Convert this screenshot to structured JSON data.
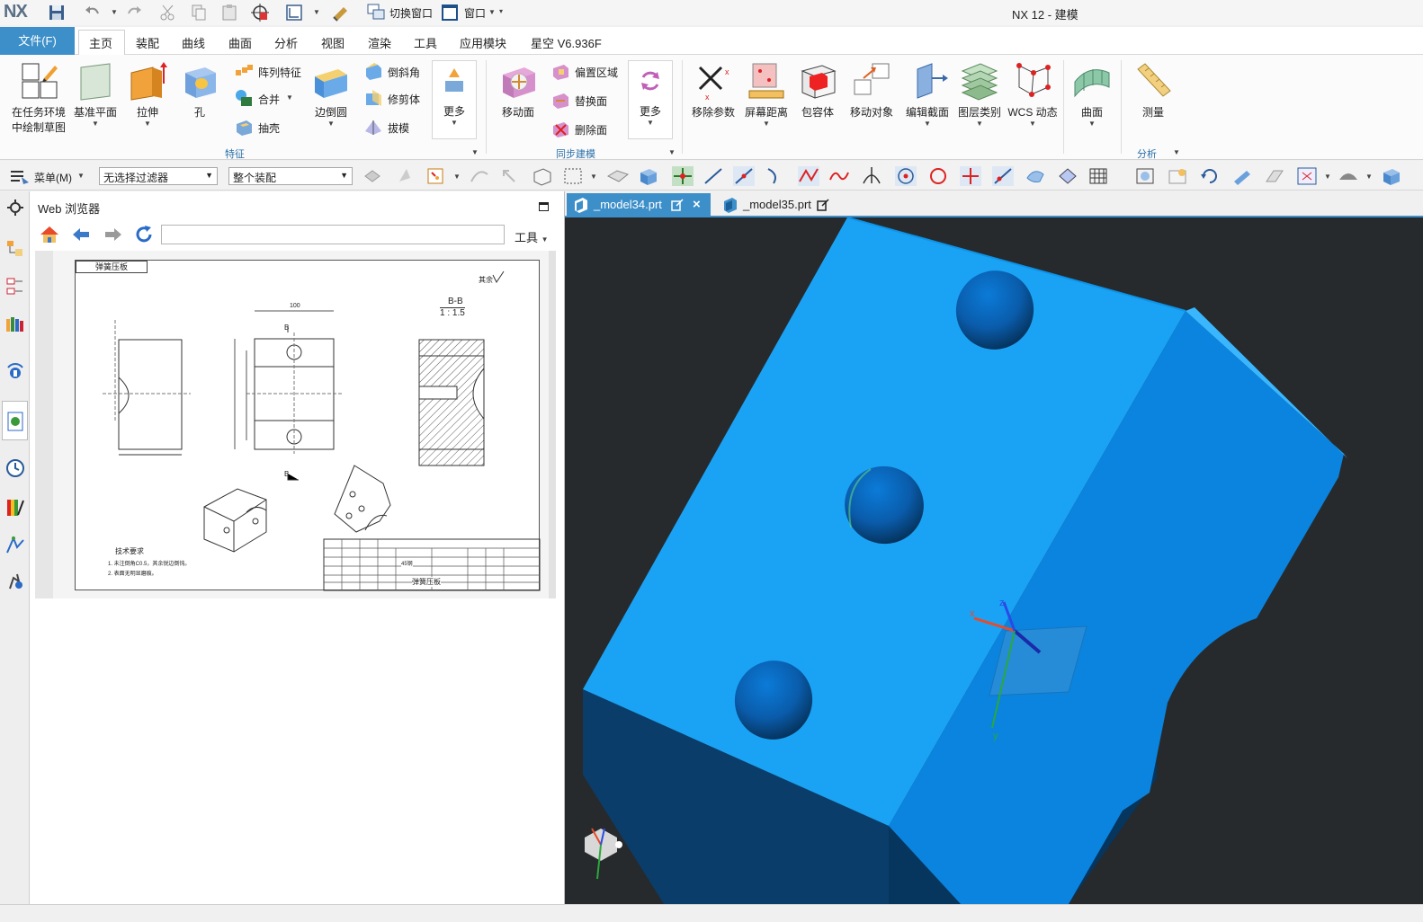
{
  "app": {
    "logo": "NX",
    "window_title": "NX 12 - 建模",
    "quick_access": {
      "switch_window": "切换窗口",
      "window": "窗口"
    }
  },
  "ribbon_tabs": {
    "file": "文件(F)",
    "items": [
      "主页",
      "装配",
      "曲线",
      "曲面",
      "分析",
      "视图",
      "渲染",
      "工具",
      "应用模块",
      "星空 V6.936F"
    ],
    "active": "主页"
  },
  "ribbon": {
    "sketch": "在任务环境\n中绘制草图",
    "sketch_l1": "在任务环境",
    "sketch_l2": "中绘制草图",
    "datum_plane": "基准平面",
    "extrude": "拉伸",
    "hole": "孔",
    "pattern_feature": "阵列特征",
    "unite": "合并",
    "shell": "抽壳",
    "edge_blend": "边倒圆",
    "chamfer": "倒斜角",
    "trim_body": "修剪体",
    "draft": "拔模",
    "more_1": "更多",
    "group_feature": "特征",
    "move_face": "移动面",
    "offset_region": "偏置区域",
    "replace_face": "替换面",
    "delete_face": "删除面",
    "more_2": "更多",
    "group_sync": "同步建模",
    "remove_params": "移除参数",
    "screen_distance": "屏幕距离",
    "bounding_body": "包容体",
    "move_object": "移动对象",
    "edit_section": "编辑截面",
    "layer_category": "图层类别",
    "wcs_dynamic": "WCS 动态",
    "surface": "曲面",
    "measure": "测量",
    "group_analysis": "分析"
  },
  "selection_bar": {
    "menu": "菜单(M)",
    "filter": "无选择过滤器",
    "scope": "整个装配"
  },
  "web_browser": {
    "title": "Web 浏览器",
    "url": "",
    "tools": "工具"
  },
  "drawing": {
    "title_box": "弹簧压板",
    "roughness": "其余",
    "section_label": "B-B",
    "section_scale": "1 : 1.5",
    "tech_req_title": "技术要求",
    "tech_req_1": "1. 未注倒角C0.5，其余锐边倒钝。",
    "tech_req_2": "2. 表面无明显磨痕。",
    "material": "45钢",
    "part_name": "弹簧压板",
    "dim_100": "100",
    "section_mark": "B"
  },
  "doc_tabs": [
    {
      "label": "_model34.prt",
      "active": true
    },
    {
      "label": "_model35.prt",
      "active": false
    }
  ],
  "colors": {
    "accent": "#3d8fc9",
    "viewport_bg": "#262a2d",
    "part_top": "#1aa3f5",
    "part_side": "#0a7fd6",
    "part_dark": "#07375e"
  }
}
